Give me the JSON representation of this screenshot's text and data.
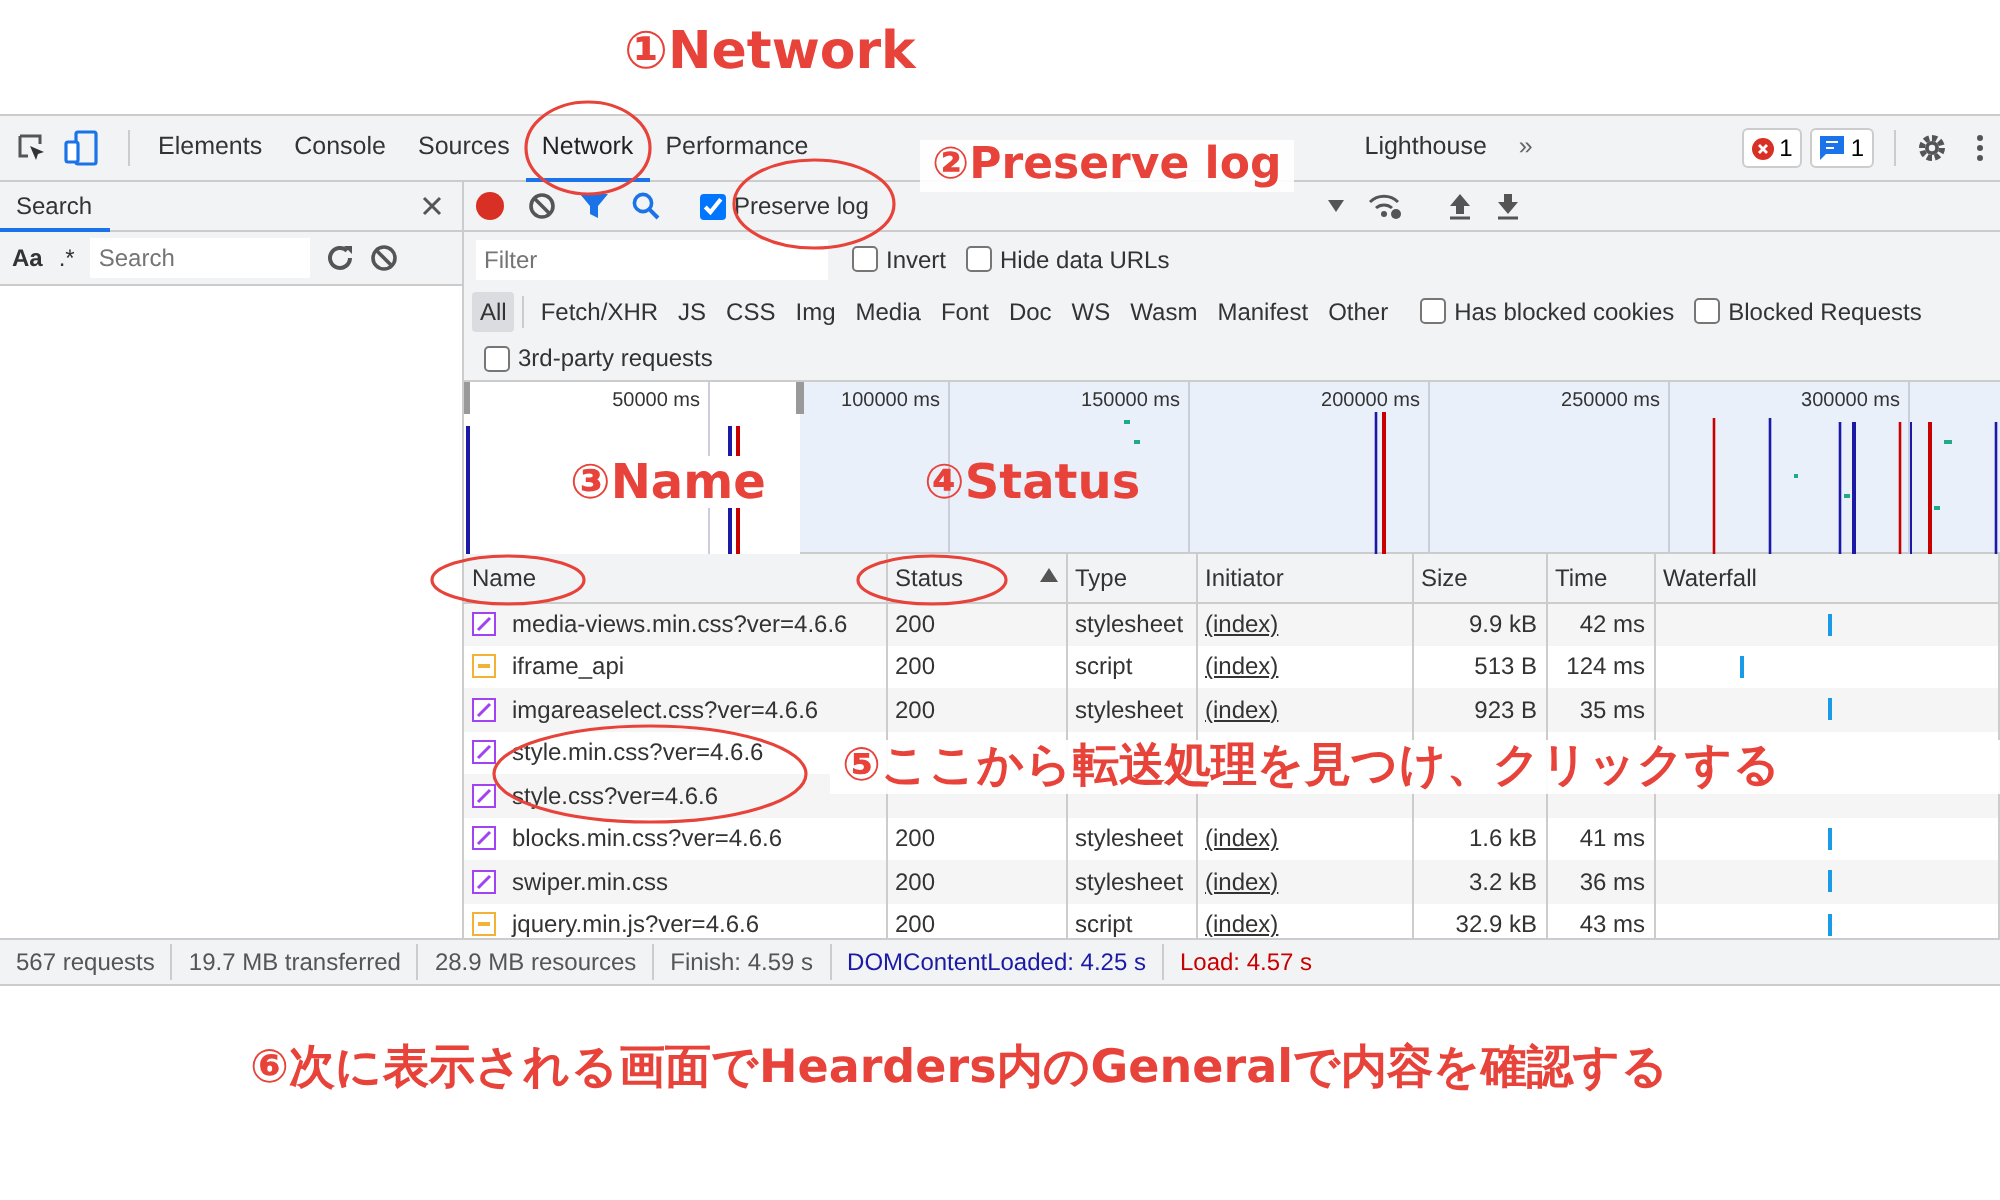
{
  "annotations": [
    {
      "label": "①Network"
    },
    {
      "label": "②Preserve log"
    },
    {
      "label": "③Name"
    },
    {
      "label": "④Status"
    },
    {
      "label": "⑤ここから転送処理を見つけ、クリックする"
    },
    {
      "label": "⑥次に表示される画面でHearders内のGeneralで内容を確認する"
    }
  ],
  "tabs": [
    {
      "label": "Elements",
      "selected": false
    },
    {
      "label": "Console",
      "selected": false
    },
    {
      "label": "Sources",
      "selected": false
    },
    {
      "label": "Network",
      "selected": true
    },
    {
      "label": "Performance",
      "selected": false
    },
    {
      "label": "Lighthouse",
      "selected": false
    }
  ],
  "more_tabs": "»",
  "issue_counts": {
    "errors": "1",
    "messages": "1"
  },
  "search_panel": {
    "title": "Search",
    "case_toggle": "Aa",
    "regex_toggle": ".*",
    "placeholder": "Search"
  },
  "toolbar": {
    "recording": true,
    "preserve_log": {
      "label": "Preserve log",
      "checked": true
    }
  },
  "filter": {
    "placeholder": "Filter",
    "options": [
      {
        "label": "Invert",
        "checked": false
      },
      {
        "label": "Hide data URLs",
        "checked": false
      }
    ]
  },
  "type_filters": [
    {
      "label": "All",
      "selected": true
    },
    {
      "label": "Fetch/XHR",
      "selected": false
    },
    {
      "label": "JS",
      "selected": false
    },
    {
      "label": "CSS",
      "selected": false
    },
    {
      "label": "Img",
      "selected": false
    },
    {
      "label": "Media",
      "selected": false
    },
    {
      "label": "Font",
      "selected": false
    },
    {
      "label": "Doc",
      "selected": false
    },
    {
      "label": "WS",
      "selected": false
    },
    {
      "label": "Wasm",
      "selected": false
    },
    {
      "label": "Manifest",
      "selected": false
    },
    {
      "label": "Other",
      "selected": false
    }
  ],
  "blocked_options": [
    {
      "label": "Has blocked cookies",
      "checked": false
    },
    {
      "label": "Blocked Requests",
      "checked": false
    }
  ],
  "third_party": {
    "label": "3rd-party requests",
    "checked": false
  },
  "overview": {
    "ticks": [
      "50000 ms",
      "100000 ms",
      "150000 ms",
      "200000 ms",
      "250000 ms",
      "300000 ms"
    ]
  },
  "columns": [
    {
      "label": "Name",
      "sorted": false
    },
    {
      "label": "Status",
      "sorted": true
    },
    {
      "label": "Type",
      "sorted": false
    },
    {
      "label": "Initiator",
      "sorted": false
    },
    {
      "label": "Size",
      "sorted": false
    },
    {
      "label": "Time",
      "sorted": false
    },
    {
      "label": "Waterfall",
      "sorted": false
    }
  ],
  "rows": [
    {
      "kind": "stylesheet",
      "name": "media-views.min.css?ver=4.6.6",
      "status": "200",
      "type": "stylesheet",
      "initiator": "(index)",
      "size": "9.9 kB",
      "time": "42 ms"
    },
    {
      "kind": "script",
      "name": "iframe_api",
      "status": "200",
      "type": "script",
      "initiator": "(index)",
      "size": "513 B",
      "time": "124 ms"
    },
    {
      "kind": "stylesheet",
      "name": "imgareaselect.css?ver=4.6.6",
      "status": "200",
      "type": "stylesheet",
      "initiator": "(index)",
      "size": "923 B",
      "time": "35 ms"
    },
    {
      "kind": "stylesheet",
      "name": "style.min.css?ver=4.6.6"
    },
    {
      "kind": "stylesheet",
      "name": "style.css?ver=4.6.6"
    },
    {
      "kind": "stylesheet",
      "name": "blocks.min.css?ver=4.6.6",
      "status": "200",
      "type": "stylesheet",
      "initiator": "(index)",
      "size": "1.6 kB",
      "time": "41 ms"
    },
    {
      "kind": "stylesheet",
      "name": "swiper.min.css",
      "status": "200",
      "type": "stylesheet",
      "initiator": "(index)",
      "size": "3.2 kB",
      "time": "36 ms"
    },
    {
      "kind": "script",
      "name": "jquery.min.js?ver=4.6.6",
      "status": "200",
      "type": "script",
      "initiator": "(index)",
      "size": "32.9 kB",
      "time": "43 ms"
    }
  ],
  "status_bar": [
    {
      "kind": "plain",
      "text": "567 requests"
    },
    {
      "kind": "plain",
      "text": "19.7 MB transferred"
    },
    {
      "kind": "plain",
      "text": "28.9 MB resources"
    },
    {
      "kind": "plain",
      "text": "Finish: 4.59 s"
    },
    {
      "kind": "dom",
      "text": "DOMContentLoaded: 4.25 s"
    },
    {
      "kind": "load",
      "text": "Load: 4.57 s"
    }
  ]
}
